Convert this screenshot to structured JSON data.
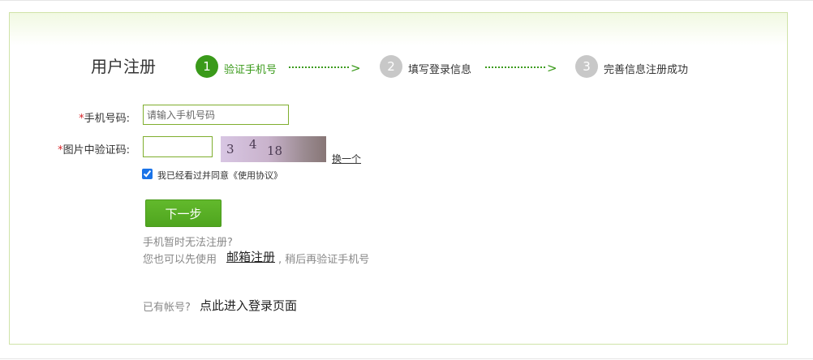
{
  "page_title": "用户注册",
  "steps": [
    {
      "number": "1",
      "label": "验证手机号"
    },
    {
      "number": "2",
      "label": "填写登录信息"
    },
    {
      "number": "3",
      "label": "完善信息注册成功"
    }
  ],
  "step_arrow": ">",
  "form": {
    "required_mark": "*",
    "phone_label": "手机号码:",
    "phone_placeholder": "请输入手机号码",
    "captcha_label": "图片中验证码:",
    "captcha_chars": [
      "3",
      "4",
      "18"
    ],
    "swap_label": "换一个",
    "agree_text": "我已经看过并同意《使用协议》",
    "agree_checked": true
  },
  "next_button": "下一步",
  "notice": {
    "line1": "手机暂时无法注册?",
    "line2_prefix": "您也可以先使用",
    "email_link": "邮箱注册",
    "line2_suffix": ", 稍后再验证手机号"
  },
  "login": {
    "prefix": "已有帐号?",
    "link": "点此进入登录页面"
  },
  "colors": {
    "accent_green": "#3a9a1a",
    "inactive_step": "#c8c8c8",
    "required_red": "#d8262b"
  }
}
